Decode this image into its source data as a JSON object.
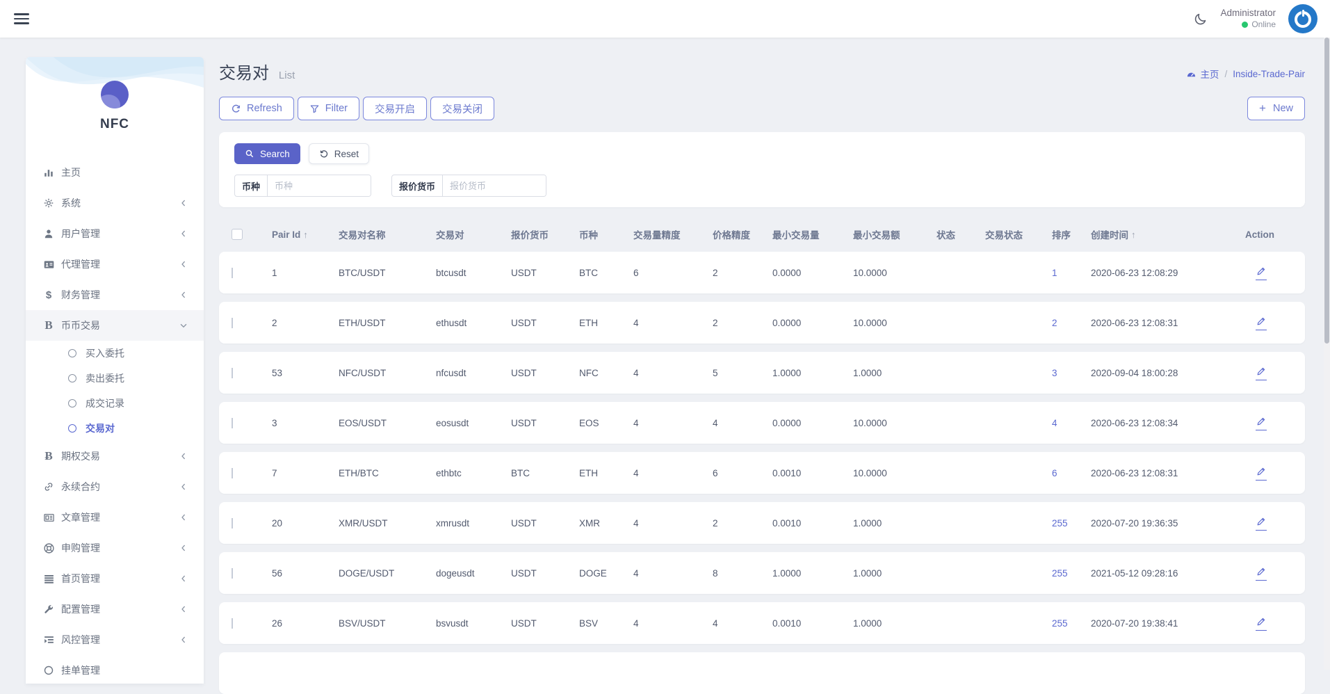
{
  "navbar": {
    "user_name": "Administrator",
    "user_status": "Online"
  },
  "sidebar": {
    "logo_text": "NFC",
    "items": [
      {
        "label": "主页",
        "icon": "bar-chart",
        "chevron": "none"
      },
      {
        "label": "系统",
        "icon": "gear",
        "chevron": "left"
      },
      {
        "label": "用户管理",
        "icon": "user",
        "chevron": "left"
      },
      {
        "label": "代理管理",
        "icon": "id-card",
        "chevron": "left"
      },
      {
        "label": "财务管理",
        "icon": "dollar",
        "chevron": "left"
      },
      {
        "label": "币币交易",
        "icon": "letter-b",
        "chevron": "down",
        "active": true,
        "children": [
          "买入委托",
          "卖出委托",
          "成交记录",
          "交易对"
        ],
        "active_child": "交易对"
      },
      {
        "label": "期权交易",
        "icon": "bitcoin",
        "chevron": "left"
      },
      {
        "label": "永续合约",
        "icon": "link",
        "chevron": "left"
      },
      {
        "label": "文章管理",
        "icon": "newspaper",
        "chevron": "left"
      },
      {
        "label": "申购管理",
        "icon": "life-ring",
        "chevron": "left"
      },
      {
        "label": "首页管理",
        "icon": "list",
        "chevron": "left"
      },
      {
        "label": "配置管理",
        "icon": "wrench",
        "chevron": "left"
      },
      {
        "label": "风控管理",
        "icon": "indent",
        "chevron": "left"
      },
      {
        "label": "挂单管理",
        "icon": "circle",
        "chevron": "none"
      }
    ]
  },
  "page": {
    "title": "交易对",
    "subtitle": "List",
    "breadcrumb_home": "主页",
    "breadcrumb_current": "Inside-Trade-Pair"
  },
  "toolbar": {
    "buttons": [
      {
        "label": "Refresh",
        "icon": "refresh"
      },
      {
        "label": "Filter",
        "icon": "funnel"
      },
      {
        "label": "交易开启",
        "icon": "none"
      },
      {
        "label": "交易关闭",
        "icon": "none"
      }
    ],
    "new_label": "New"
  },
  "filter": {
    "search_label": "Search",
    "reset_label": "Reset",
    "fields": [
      {
        "label": "币种",
        "placeholder": "币种"
      },
      {
        "label": "报价货币",
        "placeholder": "报价货币"
      }
    ]
  },
  "table": {
    "columns": [
      {
        "label": "Pair Id",
        "sort": "asc"
      },
      {
        "label": "交易对名称"
      },
      {
        "label": "交易对"
      },
      {
        "label": "报价货币"
      },
      {
        "label": "币种"
      },
      {
        "label": "交易量精度"
      },
      {
        "label": "价格精度"
      },
      {
        "label": "最小交易量"
      },
      {
        "label": "最小交易额"
      },
      {
        "label": "状态"
      },
      {
        "label": "交易状态"
      },
      {
        "label": "排序"
      },
      {
        "label": "创建时间",
        "sort": "asc"
      },
      {
        "label": "Action"
      }
    ],
    "rows": [
      {
        "pair_id": "1",
        "name": "BTC/USDT",
        "pair": "btcusdt",
        "quote": "USDT",
        "coin": "BTC",
        "vol_precision": "6",
        "price_precision": "2",
        "min_volume": "0.0000",
        "min_amount": "10.0000",
        "status": true,
        "trade_status": true,
        "sort": "1",
        "created_at": "2020-06-23 12:08:29"
      },
      {
        "pair_id": "2",
        "name": "ETH/USDT",
        "pair": "ethusdt",
        "quote": "USDT",
        "coin": "ETH",
        "vol_precision": "4",
        "price_precision": "2",
        "min_volume": "0.0000",
        "min_amount": "10.0000",
        "status": true,
        "trade_status": true,
        "sort": "2",
        "created_at": "2020-06-23 12:08:31"
      },
      {
        "pair_id": "53",
        "name": "NFC/USDT",
        "pair": "nfcusdt",
        "quote": "USDT",
        "coin": "NFC",
        "vol_precision": "4",
        "price_precision": "5",
        "min_volume": "1.0000",
        "min_amount": "1.0000",
        "status": true,
        "trade_status": true,
        "sort": "3",
        "created_at": "2020-09-04 18:00:28"
      },
      {
        "pair_id": "3",
        "name": "EOS/USDT",
        "pair": "eosusdt",
        "quote": "USDT",
        "coin": "EOS",
        "vol_precision": "4",
        "price_precision": "4",
        "min_volume": "0.0000",
        "min_amount": "10.0000",
        "status": true,
        "trade_status": true,
        "sort": "4",
        "created_at": "2020-06-23 12:08:34"
      },
      {
        "pair_id": "7",
        "name": "ETH/BTC",
        "pair": "ethbtc",
        "quote": "BTC",
        "coin": "ETH",
        "vol_precision": "4",
        "price_precision": "6",
        "min_volume": "0.0010",
        "min_amount": "10.0000",
        "status": true,
        "trade_status": true,
        "sort": "6",
        "created_at": "2020-06-23 12:08:31"
      },
      {
        "pair_id": "20",
        "name": "XMR/USDT",
        "pair": "xmrusdt",
        "quote": "USDT",
        "coin": "XMR",
        "vol_precision": "4",
        "price_precision": "2",
        "min_volume": "0.0010",
        "min_amount": "1.0000",
        "status": true,
        "trade_status": true,
        "sort": "255",
        "created_at": "2020-07-20 19:36:35"
      },
      {
        "pair_id": "56",
        "name": "DOGE/USDT",
        "pair": "dogeusdt",
        "quote": "USDT",
        "coin": "DOGE",
        "vol_precision": "4",
        "price_precision": "8",
        "min_volume": "1.0000",
        "min_amount": "1.0000",
        "status": true,
        "trade_status": true,
        "sort": "255",
        "created_at": "2021-05-12 09:28:16"
      },
      {
        "pair_id": "26",
        "name": "BSV/USDT",
        "pair": "bsvusdt",
        "quote": "USDT",
        "coin": "BSV",
        "vol_precision": "4",
        "price_precision": "4",
        "min_volume": "0.0010",
        "min_amount": "1.0000",
        "status": true,
        "trade_status": true,
        "sort": "255",
        "created_at": "2020-07-20 19:38:41"
      }
    ]
  },
  "colors": {
    "accent": "#5a63c8",
    "accent_border": "#7b87dd",
    "page_bg": "#eef0f4",
    "online_green": "#28c76f",
    "avatar_blue": "#2478c8"
  }
}
